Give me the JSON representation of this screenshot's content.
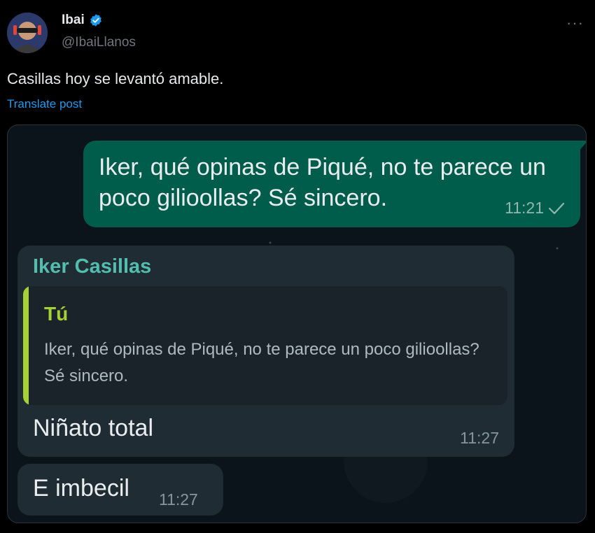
{
  "tweet": {
    "author_name": "Ibai",
    "author_handle": "@IbaiLlanos",
    "text": "Casillas hoy se levantó amable.",
    "translate_label": "Translate post",
    "more_label": "···"
  },
  "chat": {
    "outgoing": {
      "text": "Iker, qué opinas de Piqué, no te parece un poco gilioollas? Sé sincero.",
      "time": "11:21"
    },
    "incoming1": {
      "sender": "Iker Casillas",
      "quote_author": "Tú",
      "quote_text": "Iker, qué opinas de Piqué, no te parece un poco gilioollas? Sé sincero.",
      "text": "Niñato total",
      "time": "11:27"
    },
    "incoming2": {
      "text": "E imbecil",
      "time": "11:27"
    }
  },
  "colors": {
    "accent": "#1d9bf0",
    "outgoing_bubble": "#005c4b",
    "incoming_bubble": "#202c33",
    "sender_name": "#53bdaf",
    "quote_bar": "#a6d135"
  }
}
